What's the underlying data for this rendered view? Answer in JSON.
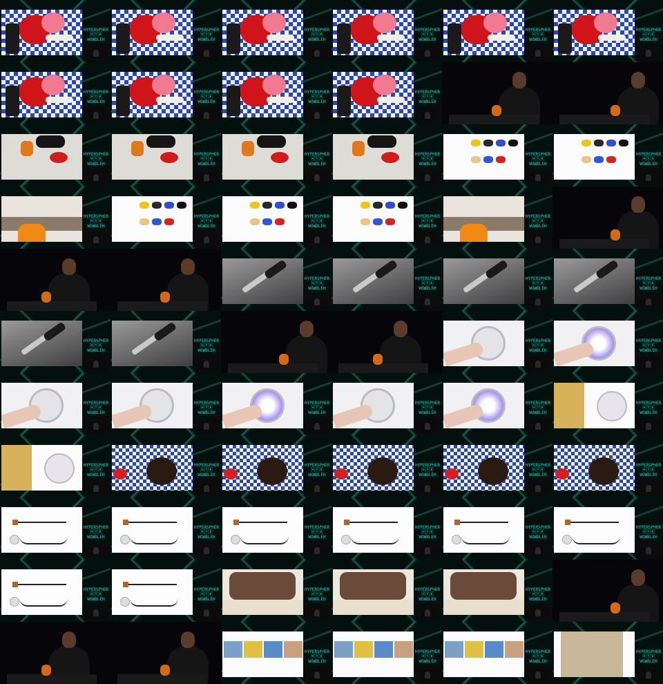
{
  "grid": {
    "columns": 6,
    "rows": 11
  },
  "logo_text": "HYPERSPHERE\n🄷🅃🄺\nWOWBLEH",
  "frames": [
    "piggy",
    "piggy",
    "piggy",
    "piggy",
    "piggy",
    "piggy",
    "piggy",
    "piggy",
    "piggy",
    "piggy",
    "speaker",
    "speaker",
    "table",
    "table",
    "table",
    "table",
    "switches",
    "switches",
    "room",
    "switches",
    "switches",
    "switches",
    "room",
    "speaker",
    "speaker",
    "speaker",
    "jack",
    "jack",
    "jack",
    "jack",
    "jack",
    "jack",
    "speaker",
    "speaker",
    "dial",
    "dial-lit",
    "dial",
    "dial",
    "dial-lit",
    "dial",
    "dial-lit",
    "board",
    "board",
    "gingham",
    "gingham",
    "gingham",
    "gingham",
    "gingham",
    "cable",
    "cable",
    "cable",
    "cable",
    "cable",
    "cable",
    "cable",
    "cable",
    "crafts",
    "crafts",
    "crafts",
    "speaker",
    "speaker",
    "speaker",
    "kids",
    "kids",
    "kids",
    "girl"
  ],
  "colors": {
    "accent": "#27d0c4",
    "background": "#04100d"
  }
}
